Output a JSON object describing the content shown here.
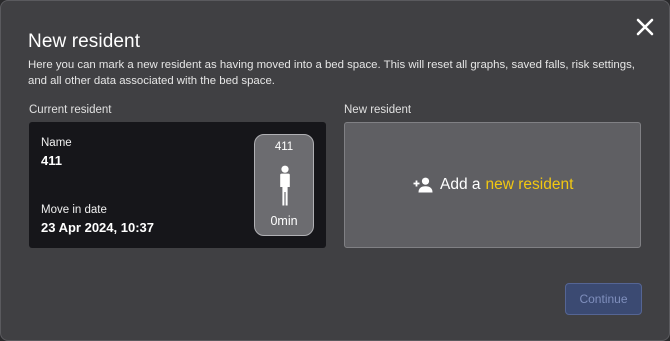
{
  "dialog": {
    "title": "New resident",
    "description": "Here you can mark a new resident as having moved into a bed space. This will reset all graphs, saved falls, risk settings, and all other data associated with the bed space.",
    "close_icon": "close-icon"
  },
  "current_resident": {
    "section_label": "Current resident",
    "name_label": "Name",
    "name_value": "411",
    "move_in_label": "Move in date",
    "move_in_value": "23 Apr 2024, 10:37",
    "tile": {
      "room": "411",
      "icon": "person-standing-icon",
      "duration": "0min"
    }
  },
  "new_resident": {
    "section_label": "New resident",
    "add_prefix": "Add a",
    "add_link": "new resident",
    "icon": "add-person-icon"
  },
  "actions": {
    "continue_label": "Continue",
    "continue_enabled": false
  },
  "colors": {
    "dialog_bg": "#404043",
    "current_card_bg": "#16161a",
    "new_card_bg": "#5f5f63",
    "accent_yellow": "#f2c811",
    "continue_bg_disabled": "#3b4a72"
  }
}
